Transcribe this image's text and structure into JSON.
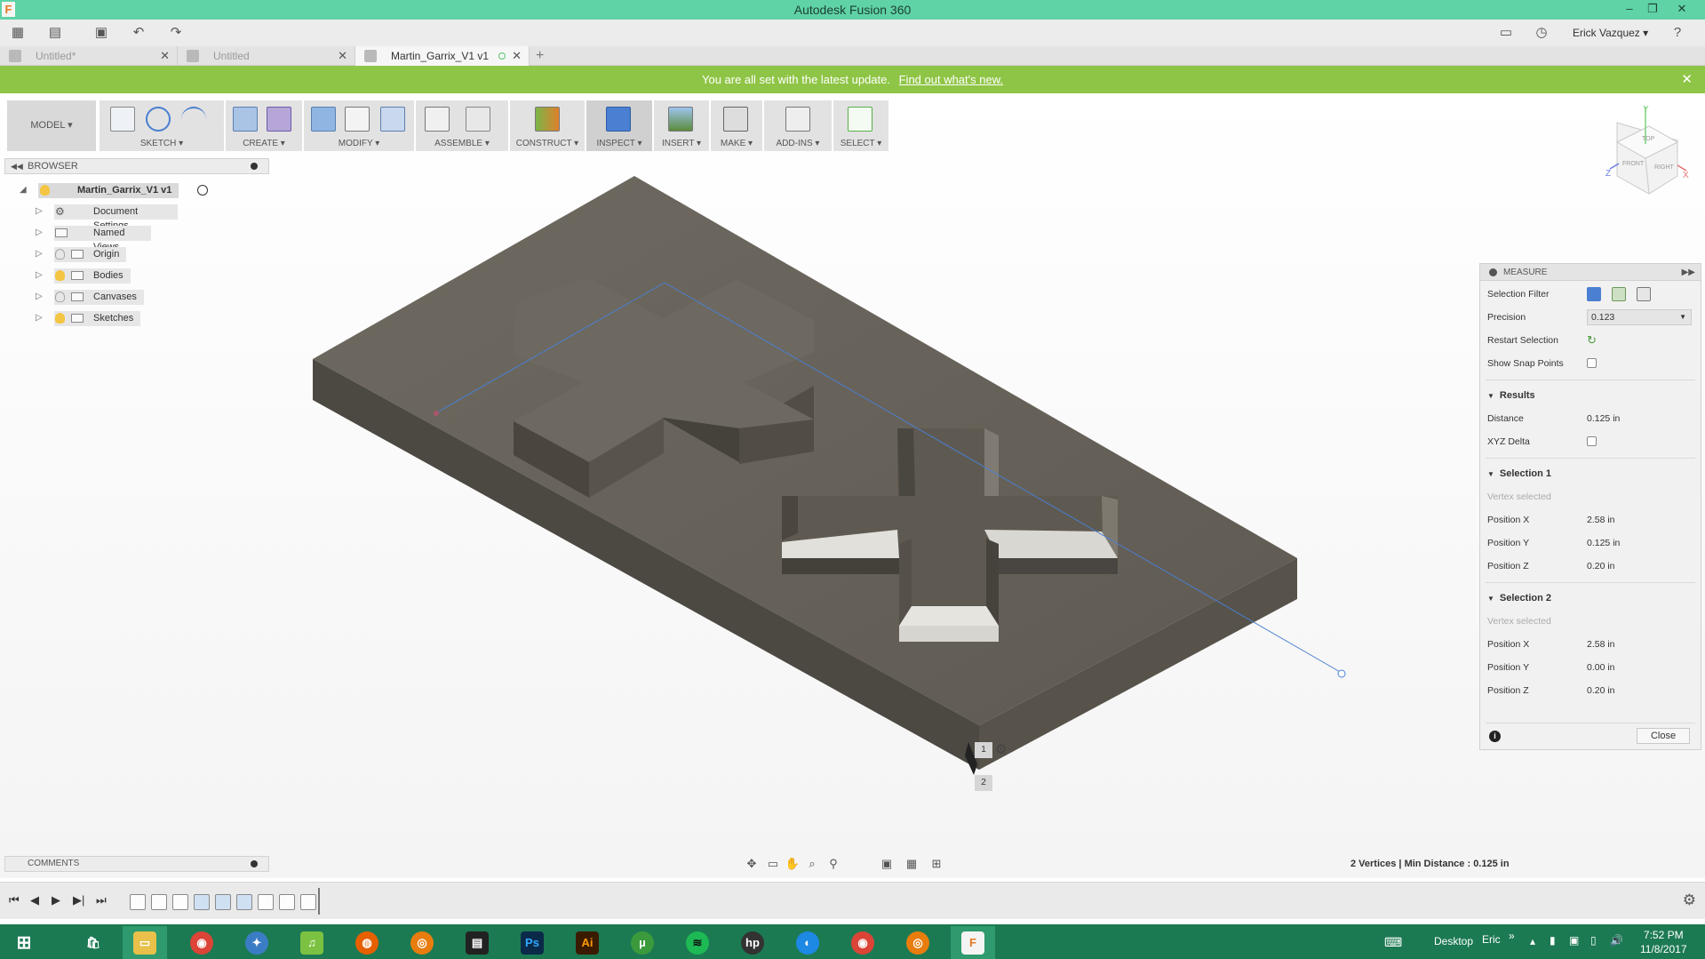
{
  "window": {
    "title": "Autodesk Fusion 360",
    "logo_letter": "F",
    "min": "–",
    "restore": "❐",
    "close": "✕"
  },
  "user": {
    "name": "Erick Vazquez"
  },
  "tabs": [
    {
      "label": "Untitled*",
      "active": false
    },
    {
      "label": "Untitled",
      "active": false
    },
    {
      "label": "Martin_Garrix_V1 v1",
      "active": true
    }
  ],
  "tab_add": "+",
  "notice": {
    "text": "You are all set with the latest update.",
    "link": "Find out what's new.",
    "close": "✕"
  },
  "ribbon": {
    "workspace": "MODEL ▾",
    "groups": [
      "SKETCH ▾",
      "CREATE ▾",
      "MODIFY ▾",
      "ASSEMBLE ▾",
      "CONSTRUCT ▾",
      "INSPECT ▾",
      "INSERT ▾",
      "MAKE ▾",
      "ADD-INS ▾",
      "SELECT ▾"
    ]
  },
  "browser": {
    "title": "BROWSER",
    "root": "Martin_Garrix_V1 v1",
    "items": [
      "Document Settings",
      "Named Views",
      "Origin",
      "Bodies",
      "Canvases",
      "Sketches"
    ]
  },
  "viewcube": {
    "top": "TOP",
    "front": "FRONT",
    "right": "RIGHT",
    "x": "X",
    "y": "Y",
    "z": "Z"
  },
  "markers": {
    "one": "1",
    "two": "2"
  },
  "measure": {
    "title": "MEASURE",
    "selection_filter_label": "Selection Filter",
    "precision_label": "Precision",
    "precision_value": "0.123",
    "restart_label": "Restart Selection",
    "snap_label": "Show Snap Points",
    "results_title": "Results",
    "distance_label": "Distance",
    "distance_value": "0.125 in",
    "xyz_label": "XYZ Delta",
    "selection1": {
      "title": "Selection 1",
      "status": "Vertex selected",
      "rows": [
        {
          "label": "Position X",
          "value": "2.58 in"
        },
        {
          "label": "Position Y",
          "value": "0.125 in"
        },
        {
          "label": "Position Z",
          "value": "0.20 in"
        }
      ]
    },
    "selection2": {
      "title": "Selection 2",
      "status": "Vertex selected",
      "rows": [
        {
          "label": "Position X",
          "value": "2.58 in"
        },
        {
          "label": "Position Y",
          "value": "0.00 in"
        },
        {
          "label": "Position Z",
          "value": "0.20 in"
        }
      ]
    },
    "info": "i",
    "close_label": "Close"
  },
  "comments": {
    "title": "COMMENTS"
  },
  "status_text": "2 Vertices | Min Distance : 0.125 in",
  "taskbar": {
    "apps": [
      {
        "name": "windows-start-icon",
        "glyph": "⊞",
        "color": "#1c7a53"
      },
      {
        "name": "store-icon",
        "glyph": "🛍",
        "color": "#1c7a53"
      },
      {
        "name": "file-explorer-icon",
        "glyph": "▭",
        "color": "#e8c04a"
      },
      {
        "name": "chrome-icon",
        "glyph": "◉",
        "color": "#db4437"
      },
      {
        "name": "app-feather-icon",
        "glyph": "✦",
        "color": "#3b7dc4"
      },
      {
        "name": "music-icon",
        "glyph": "♫",
        "color": "#7cc242"
      },
      {
        "name": "firefox-icon",
        "glyph": "◍",
        "color": "#e66000"
      },
      {
        "name": "blender-icon",
        "glyph": "◎",
        "color": "#e87d0d"
      },
      {
        "name": "film-icon",
        "glyph": "▤",
        "color": "#222222"
      },
      {
        "name": "photoshop-icon",
        "glyph": "Ps",
        "color": "#0b2a4a"
      },
      {
        "name": "illustrator-icon",
        "glyph": "Ai",
        "color": "#3b1b00"
      },
      {
        "name": "utorrent-icon",
        "glyph": "µ",
        "color": "#3b9a3b"
      },
      {
        "name": "spotify-icon",
        "glyph": "≋",
        "color": "#1db954"
      },
      {
        "name": "hp-icon",
        "glyph": "hp",
        "color": "#333333"
      },
      {
        "name": "arc-icon",
        "glyph": "◐",
        "color": "#1e88e5"
      },
      {
        "name": "chrome-2-icon",
        "glyph": "◉",
        "color": "#db4437"
      },
      {
        "name": "blender-2-icon",
        "glyph": "◎",
        "color": "#e87d0d"
      },
      {
        "name": "fusion-icon",
        "glyph": "F",
        "color": "#e47a24"
      }
    ],
    "desktop_label": "Desktop",
    "user_short": "Eric",
    "chevron": "»",
    "time": "7:52 PM",
    "date": "11/8/2017"
  }
}
